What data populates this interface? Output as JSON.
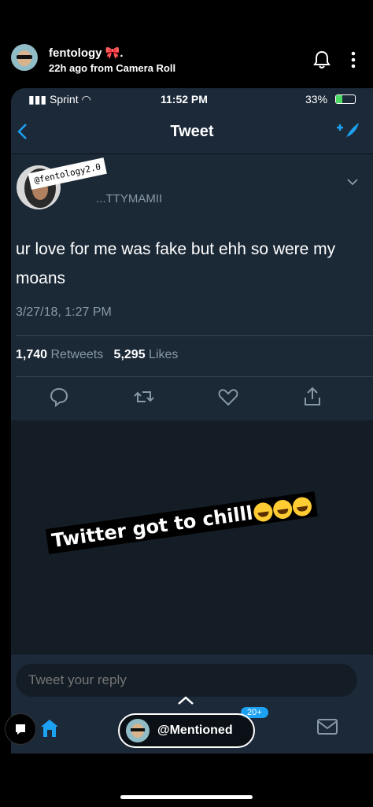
{
  "story": {
    "username": "fentology 🎀.",
    "subtitle": "22h ago from Camera Roll"
  },
  "status_bar": {
    "carrier": "Sprint",
    "time": "11:52 PM",
    "battery": "33%"
  },
  "nav": {
    "title": "Tweet"
  },
  "tweet": {
    "sticker": "@fentology2.0",
    "handle": "...TTYMAMII",
    "text": "ur love for me was fake but ehh  so were my moans",
    "date": "3/27/18, 1:27 PM",
    "retweets_count": "1,740",
    "retweets_label": "Retweets",
    "likes_count": "5,295",
    "likes_label": "Likes"
  },
  "overlay": {
    "caption": "Twitter got to chilll"
  },
  "reply": {
    "placeholder": "Tweet your reply"
  },
  "tabs": {
    "badge": "20+"
  },
  "story_footer": {
    "mention_label": "@Mentioned"
  },
  "colors": {
    "accent": "#1da1f2",
    "background": "#141d26",
    "card": "#1b2836",
    "muted": "#8899a6"
  }
}
